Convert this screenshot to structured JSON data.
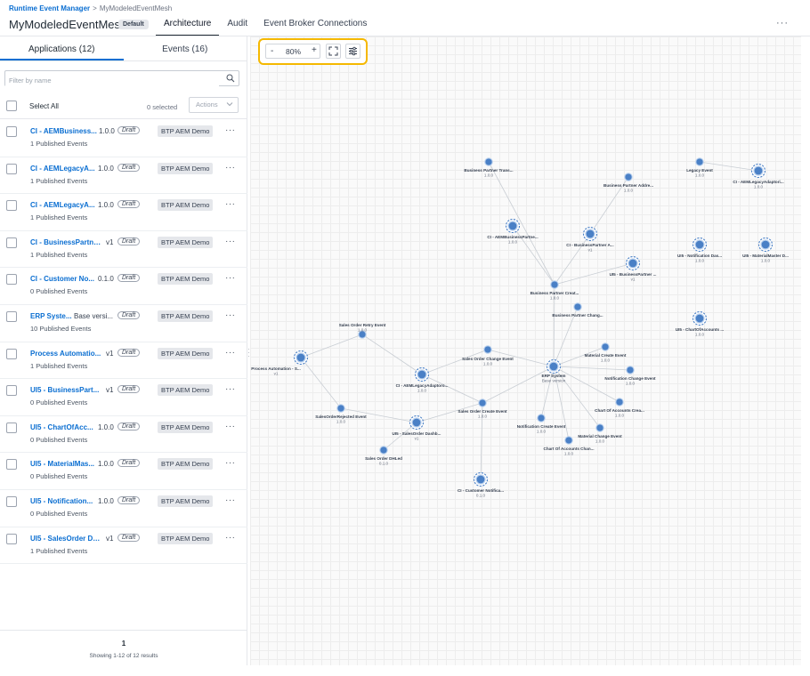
{
  "header": {
    "breadcrumb_root": "Runtime Event Manager",
    "breadcrumb_sep": ">",
    "breadcrumb_current": "MyModeledEventMesh",
    "title": "MyModeledEventMesh",
    "default_badge": "Default",
    "tabs": [
      {
        "label": "Architecture",
        "active": true
      },
      {
        "label": "Audit",
        "active": false
      },
      {
        "label": "Event Broker Connections",
        "active": false
      }
    ],
    "more_label": "···"
  },
  "left_panel": {
    "tabs": [
      {
        "label": "Applications (12)",
        "active": true
      },
      {
        "label": "Events (16)",
        "active": false
      }
    ],
    "filter_placeholder": "Filter by name",
    "select_all_label": "Select All",
    "selected_count": "0 selected",
    "actions_label": "Actions",
    "applications": [
      {
        "name": "CI - AEMBusiness...",
        "version": "1.0.0",
        "status": "Draft",
        "environment": "BTP AEM Demo",
        "events": "1 Published Events"
      },
      {
        "name": "CI - AEMLegacyA...",
        "version": "1.0.0",
        "status": "Draft",
        "environment": "BTP AEM Demo",
        "events": "1 Published Events"
      },
      {
        "name": "CI - AEMLegacyA...",
        "version": "1.0.0",
        "status": "Draft",
        "environment": "BTP AEM Demo",
        "events": "1 Published Events"
      },
      {
        "name": "CI - BusinessPartne...",
        "version": "v1",
        "status": "Draft",
        "environment": "BTP AEM Demo",
        "events": "1 Published Events"
      },
      {
        "name": "CI - Customer No...",
        "version": "0.1.0",
        "status": "Draft",
        "environment": "BTP AEM Demo",
        "events": "0 Published Events"
      },
      {
        "name": "ERP Syste...",
        "version": "Base versi...",
        "status": "Draft",
        "environment": "BTP AEM Demo",
        "events": "10 Published Events"
      },
      {
        "name": "Process Automatio...",
        "version": "v1",
        "status": "Draft",
        "environment": "BTP AEM Demo",
        "events": "1 Published Events"
      },
      {
        "name": "UI5 - BusinessPart...",
        "version": "v1",
        "status": "Draft",
        "environment": "BTP AEM Demo",
        "events": "0 Published Events"
      },
      {
        "name": "UI5 - ChartOfAcc...",
        "version": "1.0.0",
        "status": "Draft",
        "environment": "BTP AEM Demo",
        "events": "0 Published Events"
      },
      {
        "name": "UI5 - MaterialMas...",
        "version": "1.0.0",
        "status": "Draft",
        "environment": "BTP AEM Demo",
        "events": "0 Published Events"
      },
      {
        "name": "UI5 - Notification...",
        "version": "1.0.0",
        "status": "Draft",
        "environment": "BTP AEM Demo",
        "events": "0 Published Events"
      },
      {
        "name": "UI5 - SalesOrder Da...",
        "version": "v1",
        "status": "Draft",
        "environment": "BTP AEM Demo",
        "events": "1 Published Events"
      }
    ],
    "page": "1",
    "showing": "Showing 1-12 of 12 results"
  },
  "canvas": {
    "toolbar": {
      "zoom_minus": "-",
      "zoom_level": "80%",
      "zoom_plus": "+",
      "fit_icon": "fit-to-screen-icon",
      "settings_icon": "sliders-icon"
    },
    "colors": {
      "node_fill": "#4a80c6",
      "node_ring": "#bcd2ee",
      "edge": "#c9ced4",
      "highlight": "#f5b800",
      "link": "#0a6ed1"
    },
    "graph": {
      "applications": [
        {
          "id": "ci-aembp",
          "label": "CI - AEMBusinessPartne...",
          "version": "1.0.0"
        },
        {
          "id": "ci-bpa",
          "label": "CI - BusinessPartner A...",
          "version": "v1"
        },
        {
          "id": "ui5-bp",
          "label": "UI5 - BusinessPartner ...",
          "version": "v1"
        },
        {
          "id": "ci-legacy-top",
          "label": "CI - AEMLegacyAdaptori...",
          "version": "1.0.0"
        },
        {
          "id": "ui5-notif",
          "label": "UI5 - Notification Das...",
          "version": "1.0.0"
        },
        {
          "id": "ui5-material",
          "label": "UI5 - MaterialMaster D...",
          "version": "1.0.0"
        },
        {
          "id": "ui5-chart",
          "label": "UI5 - ChartOfAccounts ...",
          "version": "1.0.0"
        },
        {
          "id": "process-auto",
          "label": "Process Automation - S...",
          "version": "v1"
        },
        {
          "id": "ci-legacy",
          "label": "CI - AEMLegacyAdaptoro...",
          "version": "1.0.0"
        },
        {
          "id": "erp",
          "label": "ERP System",
          "version": "Base version"
        },
        {
          "id": "ui5-sales",
          "label": "UI5 - SalesOrder Dashb...",
          "version": "v1"
        },
        {
          "id": "ci-customer",
          "label": "CI - Customer Notifica...",
          "version": "0.1.0"
        }
      ],
      "events": [
        {
          "id": "ev-bp-trans",
          "label": "Business Partner Trans...",
          "version": "1.0.0"
        },
        {
          "id": "ev-bp-addr",
          "label": "Business Partner Addre...",
          "version": "1.0.0"
        },
        {
          "id": "ev-legacy",
          "label": "Legacy Event",
          "version": "1.0.0"
        },
        {
          "id": "ev-bp-create",
          "label": "Business Partner Creat...",
          "version": "1.0.0"
        },
        {
          "id": "ev-bp-change",
          "label": "Business Partner Chang...",
          "version": ""
        },
        {
          "id": "ev-so-retry",
          "label": "Sales Order Retry Event",
          "version": "1.0.0"
        },
        {
          "id": "ev-so-change",
          "label": "Sales Order Change Event",
          "version": "1.0.0"
        },
        {
          "id": "ev-mat-create",
          "label": "Material Create Event",
          "version": "1.0.0"
        },
        {
          "id": "ev-notif-change",
          "label": "Notification Change Event",
          "version": "1.0.0"
        },
        {
          "id": "ev-so-rejected",
          "label": "SalesOrderRejected Event",
          "version": "1.0.0"
        },
        {
          "id": "ev-so-create",
          "label": "Sales Order Create Event",
          "version": "1.0.0"
        },
        {
          "id": "ev-chart-create",
          "label": "Chart Of Accounts Crea...",
          "version": "1.0.0"
        },
        {
          "id": "ev-notif-create",
          "label": "Notification Create Event",
          "version": "1.0.0"
        },
        {
          "id": "ev-mat-change",
          "label": "Material Change Event",
          "version": "1.0.0"
        },
        {
          "id": "ev-chart-change",
          "label": "Chart Of Accounts Chan...",
          "version": "1.0.0"
        },
        {
          "id": "ev-so-dhl",
          "label": "Sales Order DHLed",
          "version": "0.1.0"
        }
      ]
    }
  }
}
